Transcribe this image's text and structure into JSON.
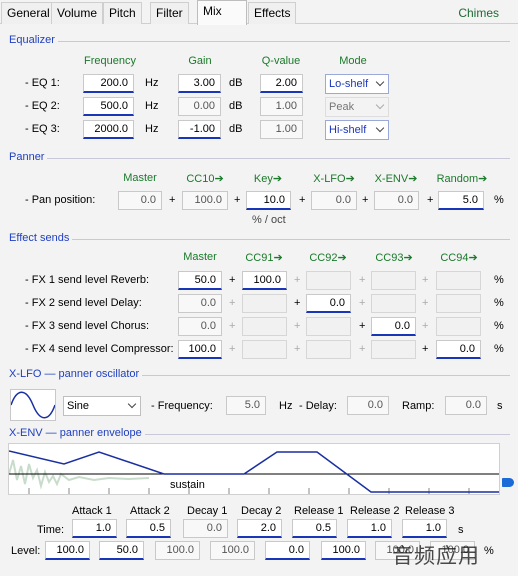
{
  "tabs": [
    {
      "label": "General",
      "active": false
    },
    {
      "label": "Volume",
      "active": false
    },
    {
      "label": "Pitch",
      "active": false
    },
    {
      "label": "Filter",
      "active": false
    },
    {
      "label": "Mix",
      "active": true
    },
    {
      "label": "Effects",
      "active": false
    }
  ],
  "brand": "Chimes",
  "equalizer": {
    "title": "Equalizer",
    "headers": {
      "frequency": "Frequency",
      "gain": "Gain",
      "q": "Q-value",
      "mode": "Mode"
    },
    "units": {
      "frequency": "Hz",
      "gain": "dB"
    },
    "rows": [
      {
        "label": "- EQ 1:",
        "frequency": "200.0",
        "gain": "3.00",
        "q": "2.00",
        "mode": "Lo-shelf"
      },
      {
        "label": "- EQ 2:",
        "frequency": "500.0",
        "gain": "0.00",
        "q": "1.00",
        "mode": "Peak"
      },
      {
        "label": "- EQ 3:",
        "frequency": "2000.0",
        "gain": "-1.00",
        "q": "1.00",
        "mode": "Hi-shelf"
      }
    ]
  },
  "panner": {
    "title": "Panner",
    "headers": [
      "Master",
      "CC10➔",
      "Key➔",
      "X-LFO➔",
      "X-ENV➔",
      "Random➔"
    ],
    "row_label": "- Pan position:",
    "values": [
      "0.0",
      "100.0",
      "10.0",
      "0.0",
      "0.0",
      "5.0"
    ],
    "plus": "+",
    "unit": "%",
    "key_unit": "% / oct"
  },
  "effect_sends": {
    "title": "Effect sends",
    "headers": [
      "Master",
      "CC91➔",
      "CC92➔",
      "CC93➔",
      "CC94➔"
    ],
    "plus": "+",
    "unit": "%",
    "rows": [
      {
        "label": "- FX 1 send level Reverb:",
        "master": "50.0",
        "cc": [
          "100.0",
          "",
          "",
          ""
        ]
      },
      {
        "label": "- FX 2 send level Delay:",
        "master": "0.0",
        "cc": [
          "",
          "0.0",
          "",
          ""
        ]
      },
      {
        "label": "- FX 3 send level Chorus:",
        "master": "0.0",
        "cc": [
          "",
          "",
          "0.0",
          ""
        ]
      },
      {
        "label": "- FX 4 send level Compressor:",
        "master": "100.0",
        "cc": [
          "",
          "",
          "",
          "0.0"
        ]
      }
    ]
  },
  "xlfo": {
    "title": "X-LFO — panner oscillator",
    "waveform": "Sine",
    "frequency_label": "- Frequency:",
    "frequency": "5.0",
    "frequency_unit": "Hz",
    "delay_label": "- Delay:",
    "delay": "0.0",
    "ramp_label": "Ramp:",
    "ramp": "0.0",
    "ramp_unit": "s"
  },
  "xenv": {
    "title": "X-ENV — panner envelope",
    "sustain_label": "sustain",
    "columns": [
      "Attack 1",
      "Attack 2",
      "Decay 1",
      "Decay 2",
      "Release 1",
      "Release 2",
      "Release 3"
    ],
    "time_label": "Time:",
    "time_unit": "s",
    "times": [
      "1.0",
      "0.5",
      "0.0",
      "2.0",
      "0.5",
      "1.0",
      "1.0"
    ],
    "level_label": "Level:",
    "level_unit": "%",
    "levels": [
      "100.0",
      "50.0",
      "100.0",
      "100.0",
      "0.0",
      "100.0",
      "100.0",
      "100.0"
    ]
  },
  "watermark": "音频应用",
  "colors": {
    "section": "#1f3fbf",
    "header": "#1a7a2a",
    "active_field": "#1a36b8",
    "envelope": "#1a2fa0"
  }
}
